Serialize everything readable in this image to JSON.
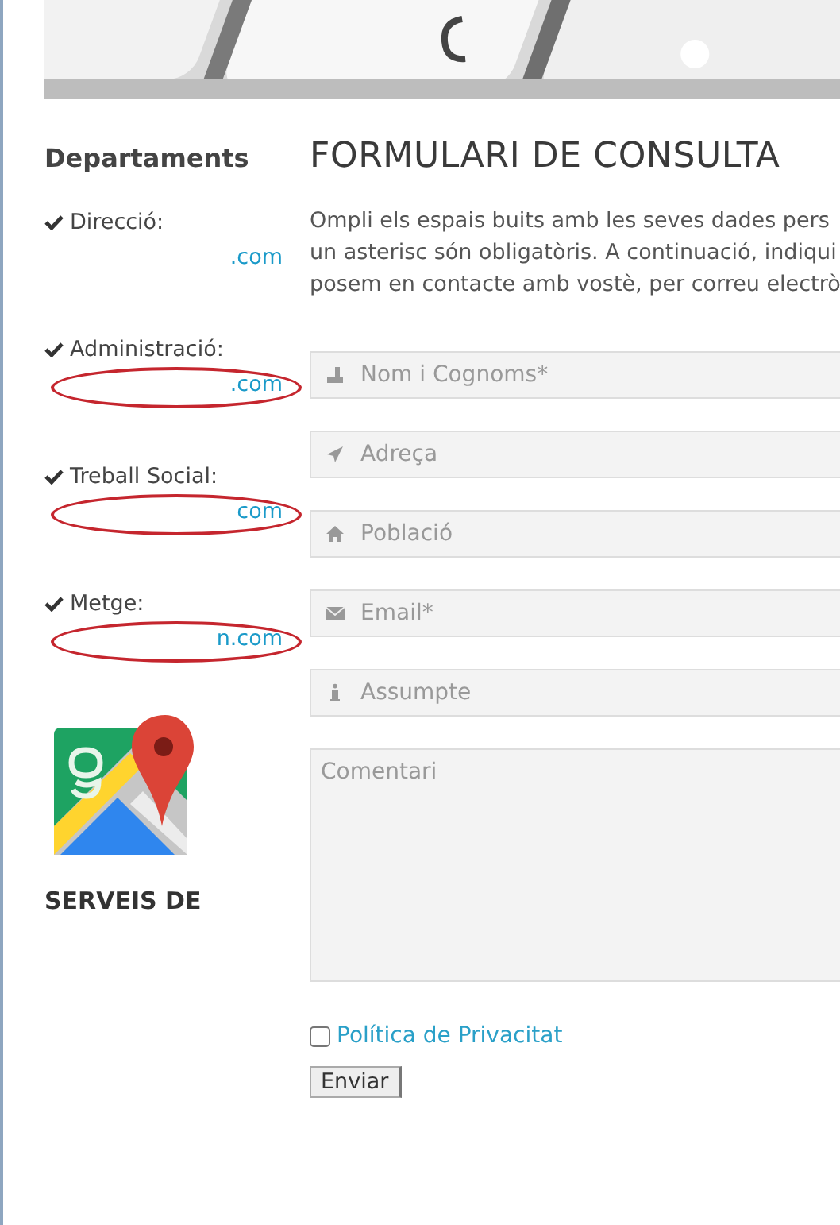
{
  "sidebar": {
    "title": "Departaments",
    "departments": [
      {
        "label": "Direcció:",
        "email": ".com",
        "circled": false
      },
      {
        "label": "Administració:",
        "email": ".com",
        "circled": true
      },
      {
        "label": "Treball Social:",
        "email": "com",
        "circled": true
      },
      {
        "label": "Metge:",
        "email": "n.com",
        "circled": true
      }
    ],
    "services_title": "SERVEIS DE"
  },
  "form": {
    "title": "FORMULARI DE CONSULTA",
    "intro": [
      "Ompli els espais buits amb les seves dades pers",
      "un asterisc són obligatòris. A continuació, indiqui",
      "posem en contacte amb vostè, per correu electrò"
    ],
    "fields": [
      {
        "kind": "input",
        "placeholder": "Nom i Cognoms*"
      },
      {
        "kind": "input",
        "placeholder": "Adreça"
      },
      {
        "kind": "input",
        "placeholder": "Població"
      },
      {
        "kind": "input",
        "placeholder": "Email*"
      },
      {
        "kind": "input",
        "placeholder": "Assumpte"
      },
      {
        "kind": "textarea",
        "placeholder": "Comentari"
      }
    ],
    "privacy": {
      "checked": false,
      "label": "Política de Privacitat"
    },
    "submit": "Enviar"
  }
}
